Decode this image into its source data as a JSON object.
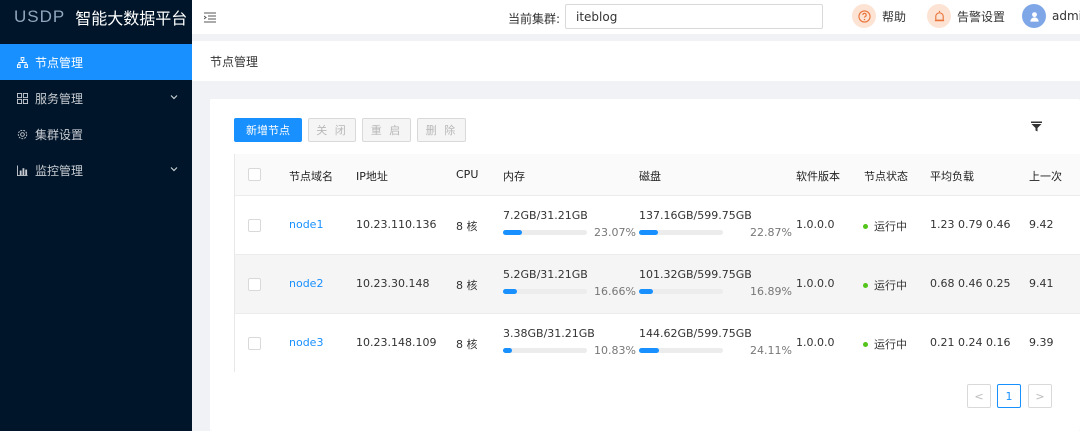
{
  "app": {
    "logo_mark": "USDP",
    "title": "智能大数据平台"
  },
  "sidebar": {
    "items": [
      {
        "label": "节点管理",
        "icon": "cluster-node-icon",
        "active": true
      },
      {
        "label": "服务管理",
        "icon": "grid-icon",
        "active": false,
        "expandable": true
      },
      {
        "label": "集群设置",
        "icon": "gear-icon",
        "active": false
      },
      {
        "label": "监控管理",
        "icon": "chart-icon",
        "active": false,
        "expandable": true
      }
    ]
  },
  "header": {
    "cluster_label": "当前集群:",
    "cluster_value": "iteblog",
    "help_label": "帮助",
    "alert_label": "告警设置",
    "user_label": "admin"
  },
  "breadcrumb": "节点管理",
  "toolbar": {
    "add_label": "新增节点",
    "close_label": "关 闭",
    "restart_label": "重 启",
    "delete_label": "删 除"
  },
  "table": {
    "columns": {
      "name": "节点域名",
      "ip": "IP地址",
      "cpu": "CPU",
      "memory": "内存",
      "disk": "磁盘",
      "version": "软件版本",
      "status": "节点状态",
      "load": "平均负载",
      "last": "上一次"
    },
    "rows": [
      {
        "name": "node1",
        "ip": "10.23.110.136",
        "cpu": "8 核",
        "mem_text": "7.2GB/31.21GB",
        "mem_pct": "23.07%",
        "mem_value": 23.07,
        "disk_text": "137.16GB/599.75GB",
        "disk_pct": "22.87%",
        "disk_value": 22.87,
        "version": "1.0.0.0",
        "status": "运行中",
        "load": "1.23 0.79 0.46",
        "last": "9.42"
      },
      {
        "name": "node2",
        "ip": "10.23.30.148",
        "cpu": "8 核",
        "mem_text": "5.2GB/31.21GB",
        "mem_pct": "16.66%",
        "mem_value": 16.66,
        "disk_text": "101.32GB/599.75GB",
        "disk_pct": "16.89%",
        "disk_value": 16.89,
        "version": "1.0.0.0",
        "status": "运行中",
        "load": "0.68 0.46 0.25",
        "last": "9.41"
      },
      {
        "name": "node3",
        "ip": "10.23.148.109",
        "cpu": "8 核",
        "mem_text": "3.38GB/31.21GB",
        "mem_pct": "10.83%",
        "mem_value": 10.83,
        "disk_text": "144.62GB/599.75GB",
        "disk_pct": "24.11%",
        "disk_value": 24.11,
        "version": "1.0.0.0",
        "status": "运行中",
        "load": "0.21 0.24 0.16",
        "last": "9.39"
      }
    ]
  },
  "pagination": {
    "prev": "<",
    "current": "1",
    "next": ">"
  },
  "colors": {
    "accent": "#1890ff",
    "sidebar_bg": "#001529",
    "status_green": "#52c41a"
  }
}
